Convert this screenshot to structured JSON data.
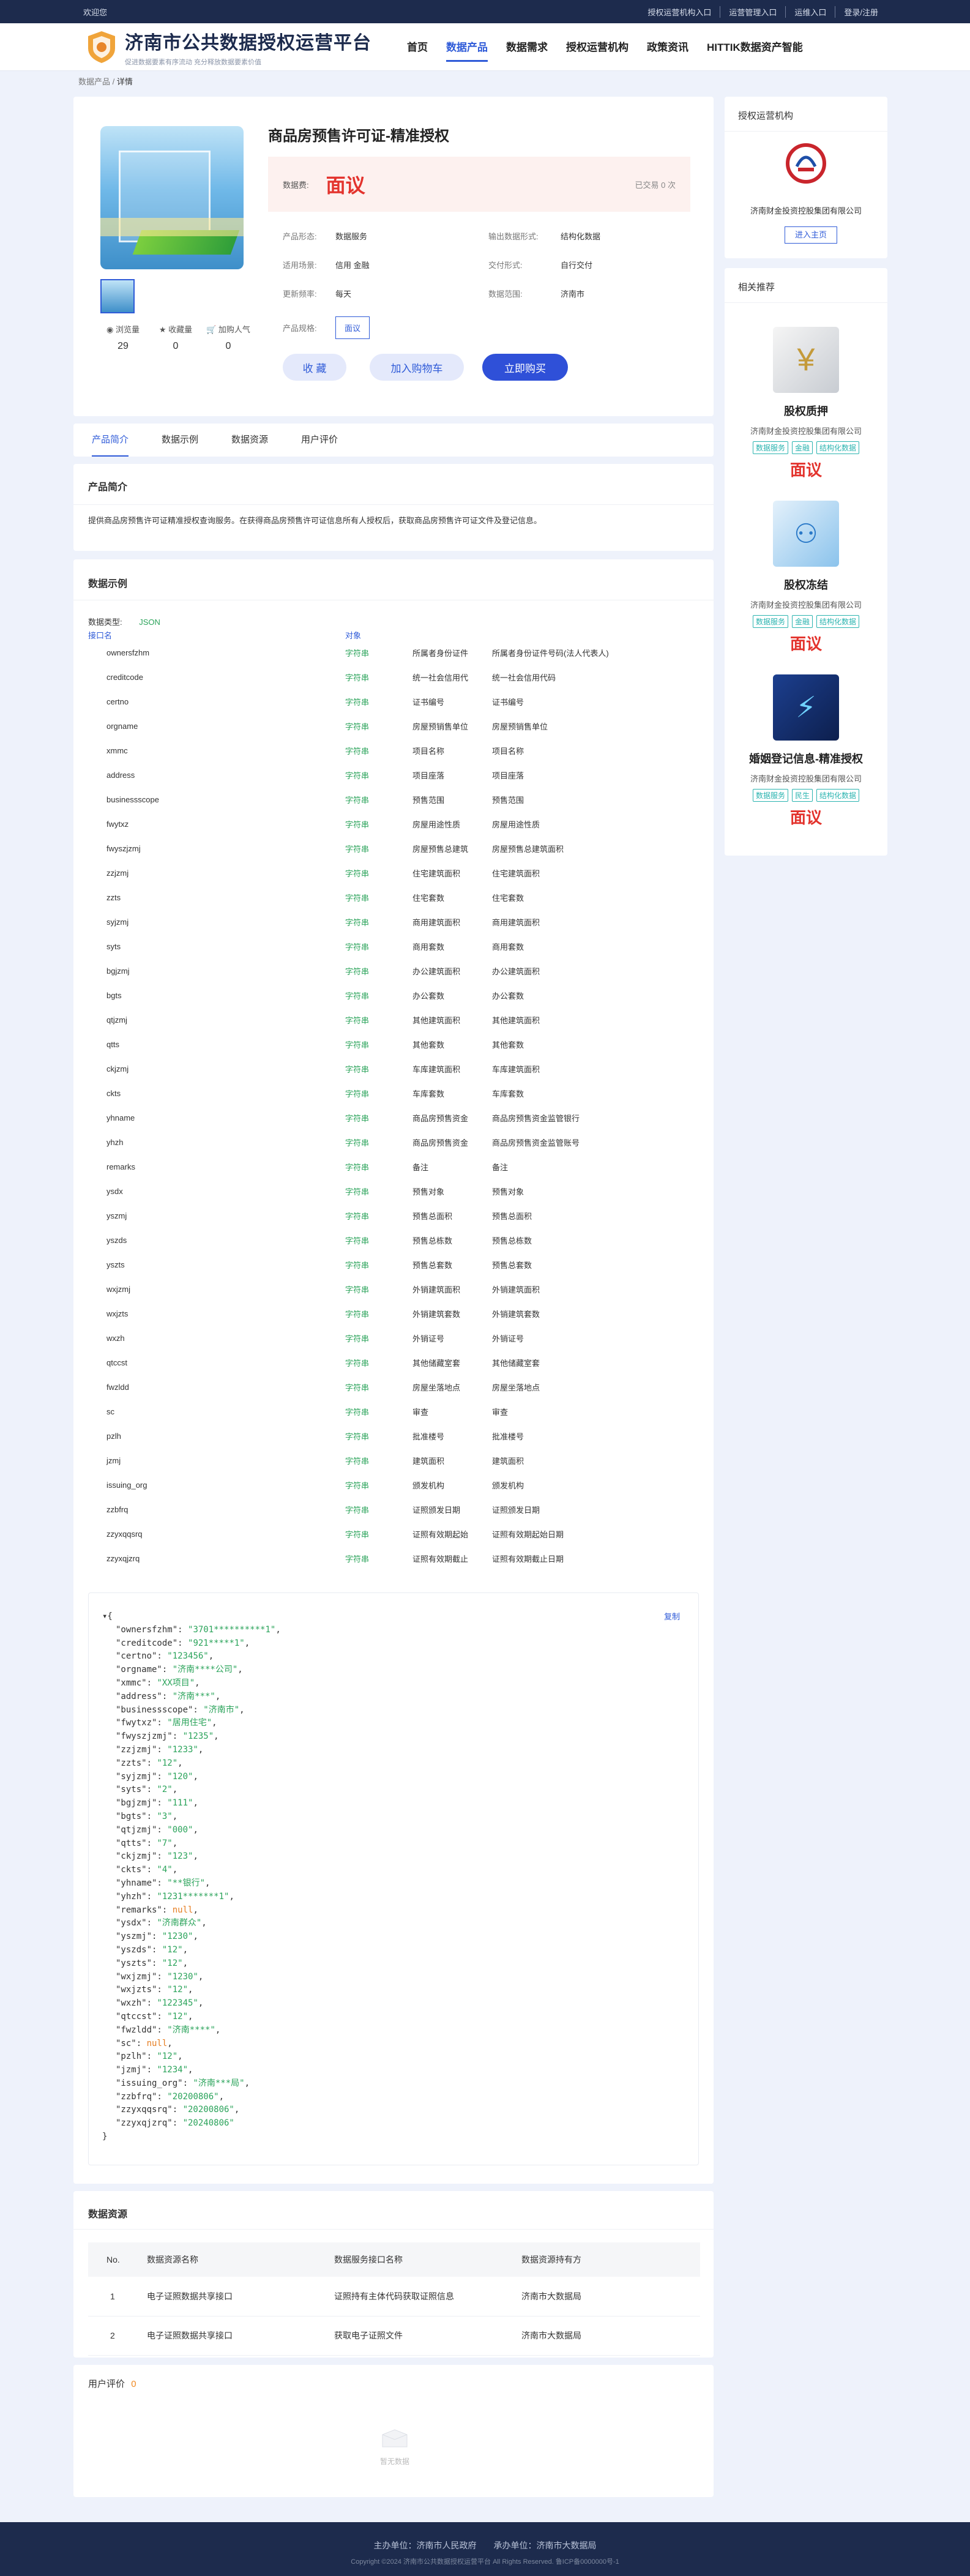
{
  "topbar": {
    "welcome": "欢迎您",
    "links": [
      "授权运营机构入口",
      "运营管理入口",
      "运维入口",
      "登录/注册"
    ]
  },
  "header": {
    "title": "济南市公共数据授权运营平台",
    "subtitle": "促进数据要素有序流动 充分释放数据要素价值",
    "nav": [
      "首页",
      "数据产品",
      "数据需求",
      "授权运营机构",
      "政策资讯",
      "HITTIK数据资产智能"
    ]
  },
  "breadcrumb": {
    "parent": "数据产品",
    "sep": "/",
    "current": "详情"
  },
  "product": {
    "title": "商品房预售许可证-精准授权",
    "price_label": "数据费:",
    "price": "面议",
    "sold": "已交易 0 次",
    "fields": [
      {
        "k": "产品形态:",
        "v": "数据服务",
        "k2": "输出数据形式:",
        "v2": "结构化数据"
      },
      {
        "k": "适用场景:",
        "v": "信用 金融",
        "k2": "交付形式:",
        "v2": "自行交付"
      },
      {
        "k": "更新频率:",
        "v": "每天",
        "k2": "数据范围:",
        "v2": "济南市"
      }
    ],
    "spec_label": "产品规格:",
    "spec": "面议",
    "stats": [
      {
        "label": "浏览量",
        "value": "29"
      },
      {
        "label": "收藏量",
        "value": "0"
      },
      {
        "label": "加购人气",
        "value": "0"
      }
    ],
    "buttons": {
      "fav": "收 藏",
      "cart": "加入购物车",
      "buy": "立即购买"
    }
  },
  "tabs": [
    "产品简介",
    "数据示例",
    "数据资源",
    "用户评价"
  ],
  "intro": {
    "title": "产品简介",
    "text": "提供商品房预售许可证精准授权查询服务。在获得商品房预售许可证信息所有人授权后，获取商品房预售许可证文件及登记信息。"
  },
  "example": {
    "title": "数据示例",
    "type_label": "数据类型:",
    "type": "JSON",
    "col1": "接口名",
    "col2": "对象",
    "fields": [
      [
        "ownersfzhm",
        "字符串",
        "所属者身份证件",
        "所属者身份证件号码(法人代表人)"
      ],
      [
        "creditcode",
        "字符串",
        "统一社会信用代",
        "统一社会信用代码"
      ],
      [
        "certno",
        "字符串",
        "证书编号",
        "证书编号"
      ],
      [
        "orgname",
        "字符串",
        "房屋预销售单位",
        "房屋预销售单位"
      ],
      [
        "xmmc",
        "字符串",
        "项目名称",
        "项目名称"
      ],
      [
        "address",
        "字符串",
        "项目座落",
        "项目座落"
      ],
      [
        "businessscope",
        "字符串",
        "预售范围",
        "预售范围"
      ],
      [
        "fwytxz",
        "字符串",
        "房屋用途性质",
        "房屋用途性质"
      ],
      [
        "fwyszjzmj",
        "字符串",
        "房屋预售总建筑",
        "房屋预售总建筑面积"
      ],
      [
        "zzjzmj",
        "字符串",
        "住宅建筑面积",
        "住宅建筑面积"
      ],
      [
        "zzts",
        "字符串",
        "住宅套数",
        "住宅套数"
      ],
      [
        "syjzmj",
        "字符串",
        "商用建筑面积",
        "商用建筑面积"
      ],
      [
        "syts",
        "字符串",
        "商用套数",
        "商用套数"
      ],
      [
        "bgjzmj",
        "字符串",
        "办公建筑面积",
        "办公建筑面积"
      ],
      [
        "bgts",
        "字符串",
        "办公套数",
        "办公套数"
      ],
      [
        "qtjzmj",
        "字符串",
        "其他建筑面积",
        "其他建筑面积"
      ],
      [
        "qtts",
        "字符串",
        "其他套数",
        "其他套数"
      ],
      [
        "ckjzmj",
        "字符串",
        "车库建筑面积",
        "车库建筑面积"
      ],
      [
        "ckts",
        "字符串",
        "车库套数",
        "车库套数"
      ],
      [
        "yhname",
        "字符串",
        "商品房预售资金",
        "商品房预售资金监管银行"
      ],
      [
        "yhzh",
        "字符串",
        "商品房预售资金",
        "商品房预售资金监管账号"
      ],
      [
        "remarks",
        "字符串",
        "备注",
        "备注"
      ],
      [
        "ysdx",
        "字符串",
        "预售对象",
        "预售对象"
      ],
      [
        "yszmj",
        "字符串",
        "预售总面积",
        "预售总面积"
      ],
      [
        "yszds",
        "字符串",
        "预售总栋数",
        "预售总栋数"
      ],
      [
        "yszts",
        "字符串",
        "预售总套数",
        "预售总套数"
      ],
      [
        "wxjzmj",
        "字符串",
        "外销建筑面积",
        "外销建筑面积"
      ],
      [
        "wxjzts",
        "字符串",
        "外销建筑套数",
        "外销建筑套数"
      ],
      [
        "wxzh",
        "字符串",
        "外销证号",
        "外销证号"
      ],
      [
        "qtccst",
        "字符串",
        "其他储藏室套",
        "其他储藏室套"
      ],
      [
        "fwzldd",
        "字符串",
        "房屋坐落地点",
        "房屋坐落地点"
      ],
      [
        "sc",
        "字符串",
        "审查",
        "审查"
      ],
      [
        "pzlh",
        "字符串",
        "批准楼号",
        "批准楼号"
      ],
      [
        "jzmj",
        "字符串",
        "建筑面积",
        "建筑面积"
      ],
      [
        "issuing_org",
        "字符串",
        "颁发机构",
        "颁发机构"
      ],
      [
        "zzbfrq",
        "字符串",
        "证照颁发日期",
        "证照颁发日期"
      ],
      [
        "zzyxqqsrq",
        "字符串",
        "证照有效期起始",
        "证照有效期起始日期"
      ],
      [
        "zzyxqjzrq",
        "字符串",
        "证照有效期截止",
        "证照有效期截止日期"
      ]
    ],
    "copy": "复制",
    "json_lines": [
      [
        "ownersfzhm",
        "\"3701**********1\""
      ],
      [
        "creditcode",
        "\"921*****1\""
      ],
      [
        "certno",
        "\"123456\""
      ],
      [
        "orgname",
        "\"济南****公司\""
      ],
      [
        "xmmc",
        "\"XX项目\""
      ],
      [
        "address",
        "\"济南***\""
      ],
      [
        "businessscope",
        "\"济南市\""
      ],
      [
        "fwytxz",
        "\"居用住宅\""
      ],
      [
        "fwyszjzmj",
        "\"1235\""
      ],
      [
        "zzjzmj",
        "\"1233\""
      ],
      [
        "zzts",
        "\"12\""
      ],
      [
        "syjzmj",
        "\"120\""
      ],
      [
        "syts",
        "\"2\""
      ],
      [
        "bgjzmj",
        "\"111\""
      ],
      [
        "bgts",
        "\"3\""
      ],
      [
        "qtjzmj",
        "\"000\""
      ],
      [
        "qtts",
        "\"7\""
      ],
      [
        "ckjzmj",
        "\"123\""
      ],
      [
        "ckts",
        "\"4\""
      ],
      [
        "yhname",
        "\"**银行\""
      ],
      [
        "yhzh",
        "\"1231*******1\""
      ],
      [
        "remarks",
        "null"
      ],
      [
        "ysdx",
        "\"济南群众\""
      ],
      [
        "yszmj",
        "\"1230\""
      ],
      [
        "yszds",
        "\"12\""
      ],
      [
        "yszts",
        "\"12\""
      ],
      [
        "wxjzmj",
        "\"1230\""
      ],
      [
        "wxjzts",
        "\"12\""
      ],
      [
        "wxzh",
        "\"122345\""
      ],
      [
        "qtccst",
        "\"12\""
      ],
      [
        "fwzldd",
        "\"济南****\""
      ],
      [
        "sc",
        "null"
      ],
      [
        "pzlh",
        "\"12\""
      ],
      [
        "jzmj",
        "\"1234\""
      ],
      [
        "issuing_org",
        "\"济南***局\""
      ],
      [
        "zzbfrq",
        "\"20200806\""
      ],
      [
        "zzyxqqsrq",
        "\"20200806\""
      ],
      [
        "zzyxqjzrq",
        "\"20240806\""
      ]
    ]
  },
  "resource": {
    "title": "数据资源",
    "headers": [
      "No.",
      "数据资源名称",
      "数据服务接口名称",
      "数据资源持有方"
    ],
    "rows": [
      [
        "1",
        "电子证照数据共享接口",
        "证照持有主体代码获取证照信息",
        "济南市大数据局"
      ],
      [
        "2",
        "电子证照数据共享接口",
        "获取电子证照文件",
        "济南市大数据局"
      ]
    ]
  },
  "review": {
    "title": "用户评价",
    "count": "0",
    "empty": "暂无数据"
  },
  "sidebar": {
    "org_title": "授权运营机构",
    "org_name": "济南财金投资控股集团有限公司",
    "org_btn": "进入主页",
    "rec_title": "相关推荐",
    "recs": [
      {
        "title": "股权质押",
        "org": "济南财金投资控股集团有限公司",
        "tags": [
          "数据服务",
          "金融",
          "结构化数据"
        ],
        "price": "面议"
      },
      {
        "title": "股权冻结",
        "org": "济南财金投资控股集团有限公司",
        "tags": [
          "数据服务",
          "金融",
          "结构化数据"
        ],
        "price": "面议"
      },
      {
        "title": "婚姻登记信息-精准授权",
        "org": "济南财金投资控股集团有限公司",
        "tags": [
          "数据服务",
          "民生",
          "结构化数据"
        ],
        "price": "面议"
      }
    ]
  },
  "footer": {
    "line1": "主办单位：济南市人民政府　　承办单位：济南市大数据局",
    "line2": "Copyright ©2024 济南市公共数据授权运营平台 All Rights Reserved. 鲁ICP备0000000号-1"
  }
}
